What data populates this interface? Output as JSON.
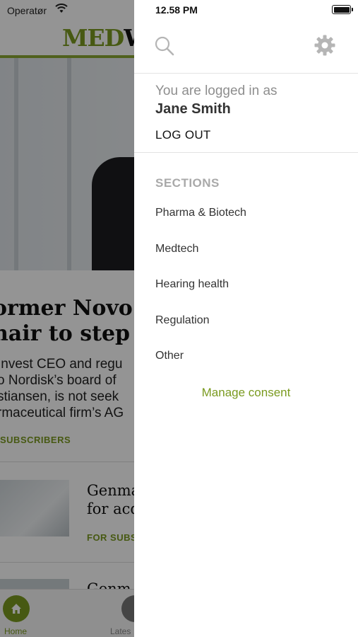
{
  "background": {
    "carrier": "Operatør",
    "logo_part1": "MED",
    "logo_part2": "W",
    "headline_line1": "ormer Novo",
    "headline_line2": "hair to step d",
    "summary_line1": " Invest CEO and regu",
    "summary_line2": "o Nordisk’s board of",
    "summary_line3": " stiansen, is not seek",
    "summary_line4": "rmaceutical firm’s AG",
    "subscribers_label": "SUBSCRIBERS",
    "article2_line1": "Genma",
    "article2_line2": "for acq",
    "article2_subs": "FOR SUBS",
    "article3_line1": "Genm",
    "tab_home": "Home",
    "tab_latest": "Lates"
  },
  "menu": {
    "time": "12.58 PM",
    "logged_in_label": "You are logged in as",
    "user_name": "Jane Smith",
    "logout_label": "LOG OUT",
    "sections_heading": "SECTIONS",
    "sections": [
      "Pharma & Biotech",
      "Medtech",
      "Hearing health",
      "Regulation",
      "Other"
    ],
    "manage_consent": "Manage consent"
  },
  "colors": {
    "accent": "#7a9a1f",
    "muted_text": "#8e8e8e",
    "section_heading": "#a9a9a9"
  },
  "icons": [
    "search-icon",
    "gear-icon",
    "wifi-icon",
    "battery-icon",
    "home-icon"
  ]
}
